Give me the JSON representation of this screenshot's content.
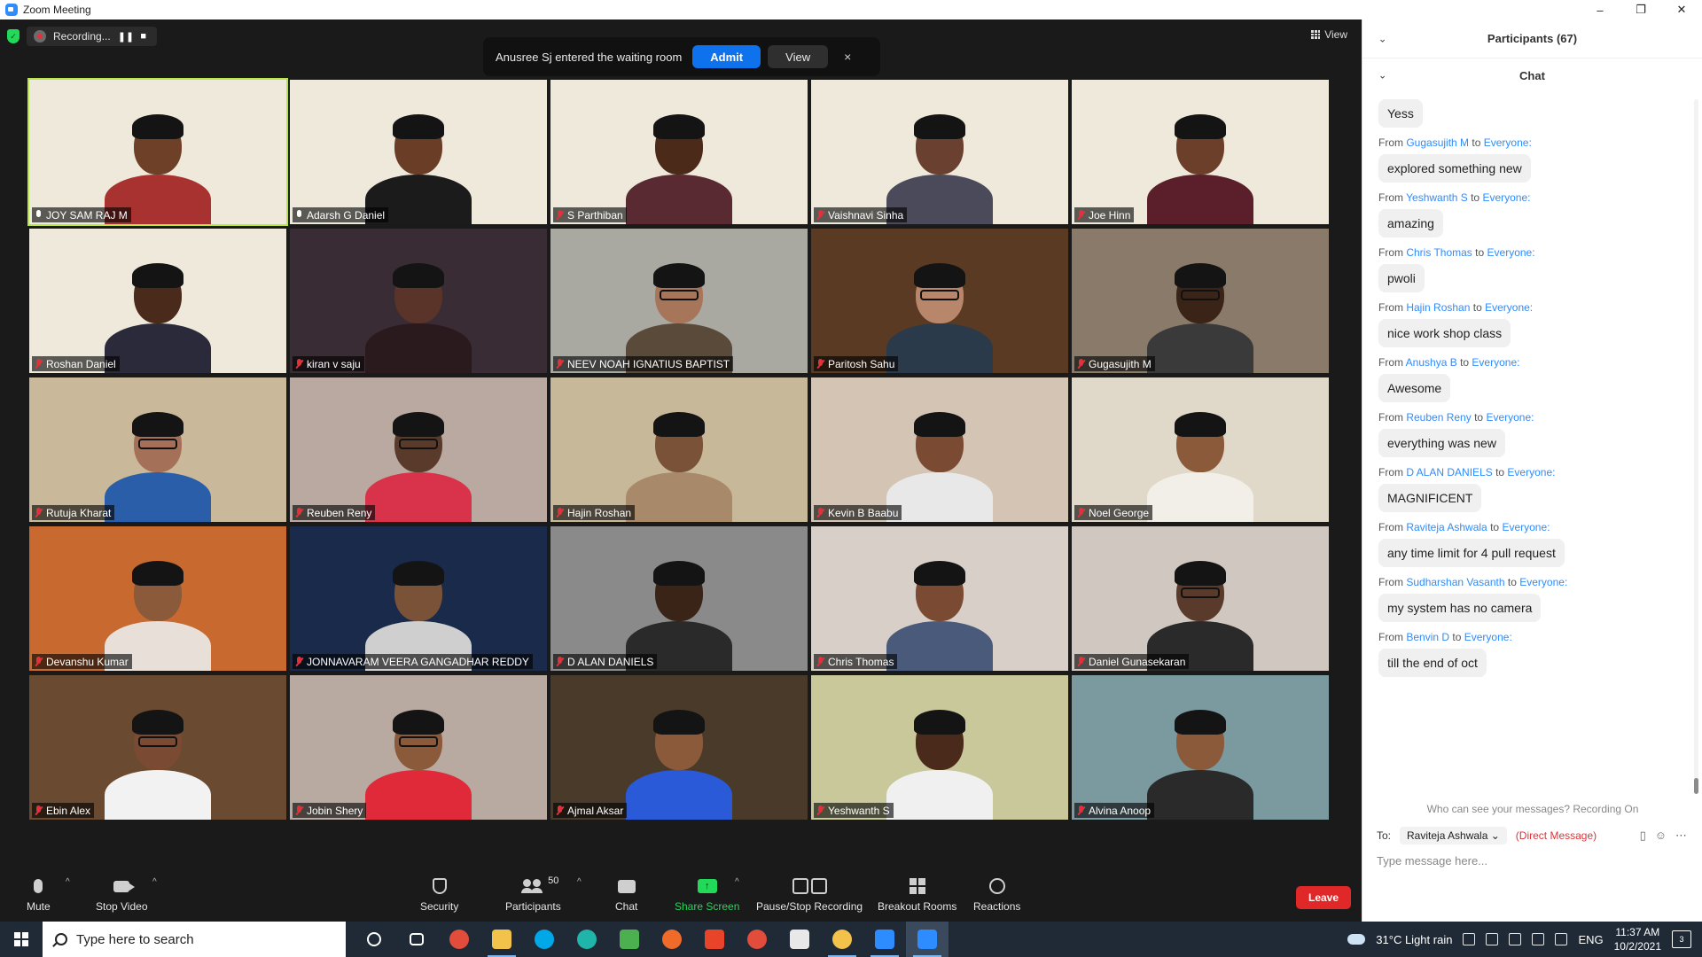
{
  "window": {
    "title": "Zoom Meeting",
    "controls": {
      "minimize": "–",
      "restore": "❐",
      "close": "✕"
    }
  },
  "recording": {
    "label": "Recording...",
    "pause": "❚❚",
    "stop": "■"
  },
  "notification": {
    "text": "Anusree Sj entered the waiting room",
    "admit_label": "Admit",
    "view_label": "View",
    "close": "×"
  },
  "view_button": {
    "label": "View"
  },
  "tiles": [
    {
      "name": "JOY SAM RAJ M",
      "muted": false,
      "active": true,
      "bg": "#efe9dc",
      "skin": "#6e4028",
      "shirt": "#a8322f",
      "hackathon": true,
      "glasses": false
    },
    {
      "name": "Adarsh G Daniel",
      "muted": false,
      "active": false,
      "bg": "#efe9dc",
      "skin": "#6a3e26",
      "shirt": "#1b1b1b",
      "hackathon": true,
      "glasses": false
    },
    {
      "name": "S Parthiban",
      "muted": true,
      "active": false,
      "bg": "#efe9dc",
      "skin": "#4c2a1a",
      "shirt": "#5a2a33",
      "hackathon": true,
      "glasses": false
    },
    {
      "name": "Vaishnavi Sinha",
      "muted": true,
      "active": false,
      "bg": "#efe9dc",
      "skin": "#6a4030",
      "shirt": "#4a4a5a",
      "hackathon": true,
      "glasses": false
    },
    {
      "name": "Joe Hinn",
      "muted": true,
      "active": false,
      "bg": "#efe9dc",
      "skin": "#6b3f2a",
      "shirt": "#5a1f2a",
      "hackathon": true,
      "glasses": false
    },
    {
      "name": "Roshan Daniel",
      "muted": true,
      "active": false,
      "bg": "#efe9dc",
      "skin": "#4a2a1a",
      "shirt": "#2a2a3a",
      "hackathon": true,
      "glasses": false
    },
    {
      "name": "kiran v saju",
      "muted": true,
      "active": false,
      "bg": "#3a2c34",
      "skin": "#5a3428",
      "shirt": "#2a1a1e",
      "hackathon": false,
      "glasses": false
    },
    {
      "name": "NEEV NOAH  IGNATIUS BAPTIST",
      "muted": true,
      "active": false,
      "bg": "#a9a9a2",
      "skin": "#a7765a",
      "shirt": "#5a4a3a",
      "hackathon": false,
      "glasses": true
    },
    {
      "name": "Paritosh Sahu",
      "muted": true,
      "active": false,
      "bg": "#5a3a22",
      "skin": "#b8866a",
      "shirt": "#2a3a4a",
      "hackathon": false,
      "glasses": true
    },
    {
      "name": "Gugasujith M",
      "muted": true,
      "active": false,
      "bg": "#8a7a6a",
      "skin": "#3a2418",
      "shirt": "#3a3a3a",
      "hackathon": false,
      "glasses": true
    },
    {
      "name": "Rutuja Kharat",
      "muted": true,
      "active": false,
      "bg": "#c9b89a",
      "skin": "#a47058",
      "shirt": "#2a5ea8",
      "hackathon": false,
      "glasses": true
    },
    {
      "name": "Reuben Reny",
      "muted": true,
      "active": false,
      "bg": "#b9a9a0",
      "skin": "#5a3a2a",
      "shirt": "#d8334a",
      "hackathon": false,
      "glasses": true
    },
    {
      "name": "Hajin Roshan",
      "muted": true,
      "active": false,
      "bg": "#c8b89a",
      "skin": "#7a5238",
      "shirt": "#a88a6a",
      "hackathon": false,
      "glasses": false
    },
    {
      "name": "Kevin B Baabu",
      "muted": true,
      "active": false,
      "bg": "#d4c4b4",
      "skin": "#7a4a32",
      "shirt": "#e8e8e8",
      "hackathon": false,
      "glasses": false
    },
    {
      "name": "Noel George",
      "muted": true,
      "active": false,
      "bg": "#e0d8c8",
      "skin": "#8a5a3a",
      "shirt": "#f2eee8",
      "hackathon": false,
      "glasses": false
    },
    {
      "name": "Devanshu Kumar",
      "muted": true,
      "active": false,
      "bg": "#c86a30",
      "skin": "#8a5a3a",
      "shirt": "#e8e0d8",
      "hackathon": false,
      "glasses": false
    },
    {
      "name": "JONNAVARAM VEERA GANGADHAR REDDY",
      "muted": true,
      "active": false,
      "bg": "#1a2a4a",
      "skin": "#7a5238",
      "shirt": "#cfcfcf",
      "hackathon": false,
      "glasses": false
    },
    {
      "name": "D ALAN DANIELS",
      "muted": true,
      "active": false,
      "bg": "#8a8a8a",
      "skin": "#3a2418",
      "shirt": "#2a2a2a",
      "hackathon": false,
      "glasses": false
    },
    {
      "name": "Chris Thomas",
      "muted": true,
      "active": false,
      "bg": "#d8d0c8",
      "skin": "#7a4a32",
      "shirt": "#4a5a7a",
      "hackathon": false,
      "glasses": false
    },
    {
      "name": "Daniel Gunasekaran",
      "muted": true,
      "active": false,
      "bg": "#d0c8c0",
      "skin": "#5a3a2a",
      "shirt": "#2a2a2a",
      "hackathon": false,
      "glasses": true
    },
    {
      "name": "Ebin Alex",
      "muted": true,
      "active": false,
      "bg": "#6a4a30",
      "skin": "#7a4a32",
      "shirt": "#f2f2f2",
      "hackathon": false,
      "glasses": true
    },
    {
      "name": "Jobin Shery",
      "muted": true,
      "active": false,
      "bg": "#b8aaa0",
      "skin": "#8a5a3a",
      "shirt": "#e02a3a",
      "hackathon": false,
      "glasses": true
    },
    {
      "name": "Ajmal Aksar",
      "muted": true,
      "active": false,
      "bg": "#4a3a2a",
      "skin": "#8a5a3a",
      "shirt": "#2a5ad8",
      "hackathon": false,
      "glasses": false
    },
    {
      "name": "Yeshwanth S",
      "muted": true,
      "active": false,
      "bg": "#c8c89a",
      "skin": "#4a2a1a",
      "shirt": "#f0f0f0",
      "hackathon": false,
      "glasses": false
    },
    {
      "name": "Alvina Anoop",
      "muted": true,
      "active": false,
      "bg": "#7a9aa0",
      "skin": "#8a5a3a",
      "shirt": "#2a2a2a",
      "hackathon": false,
      "glasses": false
    }
  ],
  "toolbar": {
    "mute": "Mute",
    "stop_video": "Stop Video",
    "security": "Security",
    "participants": "Participants",
    "participants_count": "50",
    "chat": "Chat",
    "share_screen": "Share Screen",
    "record": "Pause/Stop Recording",
    "breakout": "Breakout Rooms",
    "reactions": "Reactions",
    "leave": "Leave",
    "caret": "^"
  },
  "panel": {
    "participants_header": "Participants (67)",
    "chat_header": "Chat",
    "chevron": "⌄",
    "messages": [
      {
        "from": "",
        "to": "",
        "text": "Yess"
      },
      {
        "from": "Gugasujith M",
        "to": "Everyone:",
        "text": "explored something new"
      },
      {
        "from": "Yeshwanth S",
        "to": "Everyone:",
        "text": "amazing"
      },
      {
        "from": "Chris Thomas",
        "to": "Everyone:",
        "text": "pwoli"
      },
      {
        "from": "Hajin Roshan",
        "to": "Everyone:",
        "text": "nice work shop class"
      },
      {
        "from": "Anushya B",
        "to": "Everyone:",
        "text": "Awesome"
      },
      {
        "from": "Reuben Reny",
        "to": "Everyone:",
        "text": "everything was new"
      },
      {
        "from": "D ALAN DANIELS",
        "to": "Everyone:",
        "text": "MAGNIFICENT"
      },
      {
        "from": "Raviteja Ashwala",
        "to": "Everyone:",
        "text": "any time limit for 4 pull request"
      },
      {
        "from": "Sudharshan Vasanth",
        "to": "Everyone:",
        "text": "my system has no camera"
      },
      {
        "from": "Benvin D",
        "to": "Everyone:",
        "text": "till the end of oct"
      }
    ],
    "from_word": "From",
    "to_word": "to",
    "who_can_see": "Who can see your messages? Recording On",
    "to_label": "To:",
    "to_recipient": "Raviteja Ashwala ⌄",
    "direct_message": "(Direct Message)",
    "input_placeholder": "Type message here..."
  },
  "taskbar": {
    "search_placeholder": "Type here to search",
    "weather": "31°C  Light rain",
    "language": "ENG",
    "time": "11:37 AM",
    "date": "10/2/2021",
    "notifications": "3",
    "apps": [
      {
        "name": "cortana-icon",
        "color": "#1f2a36",
        "shape": "circle-outline"
      },
      {
        "name": "task-view-icon",
        "color": "#1f2a36",
        "shape": "sq"
      },
      {
        "name": "chrome-icon",
        "color": "#e24c3a",
        "shape": "circle"
      },
      {
        "name": "file-explorer-icon",
        "color": "#f2c24a",
        "shape": "sq"
      },
      {
        "name": "skype-icon",
        "color": "#00a8e8",
        "shape": "circle"
      },
      {
        "name": "edge-icon",
        "color": "#1fb5a8",
        "shape": "circle"
      },
      {
        "name": "spreadsheet-icon",
        "color": "#4caf50",
        "shape": "sq"
      },
      {
        "name": "firefox-icon",
        "color": "#f06a2a",
        "shape": "circle"
      },
      {
        "name": "office-icon",
        "color": "#e8442a",
        "shape": "sq"
      },
      {
        "name": "chrome-icon-2",
        "color": "#e24c3a",
        "shape": "circle"
      },
      {
        "name": "store-icon",
        "color": "#e8e8e8",
        "shape": "sq"
      },
      {
        "name": "chrome-icon-3",
        "color": "#f2c24a",
        "shape": "circle"
      },
      {
        "name": "photos-icon",
        "color": "#2d8cff",
        "shape": "sq"
      },
      {
        "name": "zoom-icon",
        "color": "#2d8cff",
        "shape": "sq"
      }
    ]
  },
  "colors": {
    "zoom_blue": "#2d8cff",
    "admit_blue": "#0e72ed",
    "leave_red": "#e02828",
    "share_green": "#23d959",
    "active_speaker": "#b8e64a"
  }
}
